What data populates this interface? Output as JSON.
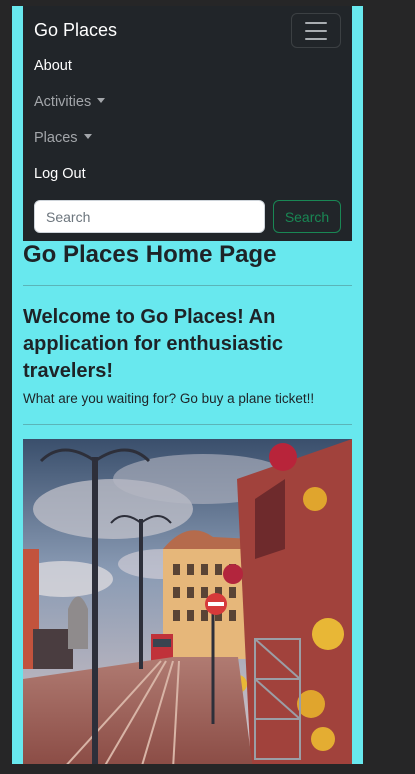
{
  "navbar": {
    "brand": "Go Places",
    "items": [
      {
        "label": "About",
        "state": "active"
      },
      {
        "label": "Activities",
        "state": "dropdown"
      },
      {
        "label": "Places",
        "state": "dropdown"
      },
      {
        "label": "Log Out",
        "state": "active"
      }
    ],
    "search": {
      "placeholder": "Search",
      "button_label": "Search"
    }
  },
  "main": {
    "title": "Go Places Home Page",
    "welcome": "Welcome to Go Places! An application for enthusiastic travelers!",
    "tagline": "What are you waiting for? Go buy a plane ticket!!",
    "hero_image": "city-street-tram-photo"
  },
  "colors": {
    "background": "#68e8ee",
    "navbar": "#212529",
    "search_button": "#198754"
  }
}
